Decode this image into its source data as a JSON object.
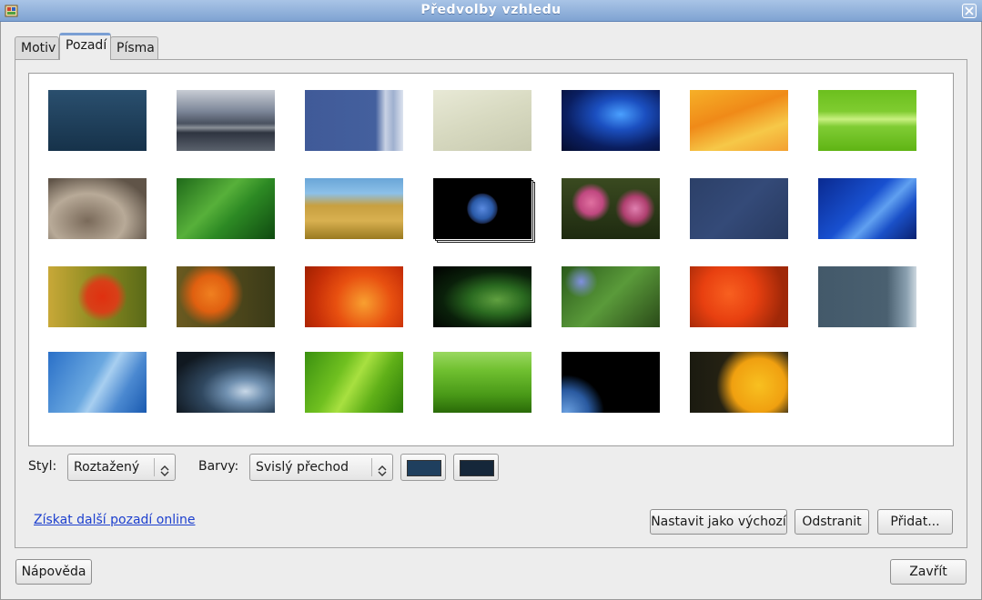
{
  "window": {
    "title": "Předvolby vzhledu"
  },
  "tabs": [
    {
      "label": "Motiv"
    },
    {
      "label": "Pozadí"
    },
    {
      "label": "Písma"
    }
  ],
  "options": {
    "style_label": "Styl:",
    "style_value": "Roztažený",
    "colors_label": "Barvy:",
    "colors_value": "Svislý přechod",
    "primary_color": "#1f3f5e",
    "secondary_color": "#15273a"
  },
  "link": {
    "more_online": "Získat další pozadí online"
  },
  "buttons": {
    "set_default": "Nastavit jako výchozí",
    "remove": "Odstranit",
    "add": "Přidat...",
    "help": "Nápověda",
    "close": "Zavřít"
  },
  "wallpapers": {
    "selected_index": 4,
    "items": [
      "solid-blue",
      "stormy-sky",
      "blue-curtain",
      "sand",
      "blue-swirl",
      "orange-waves",
      "green-waves",
      "stone-fountain",
      "green-leaves",
      "wheat-field",
      "earth",
      "pink-flowers",
      "denim",
      "blue-abstract",
      "red-flower",
      "orange-flower",
      "orange-petals",
      "leaf-bug",
      "blue-flowers",
      "orange-blooms",
      "slate-bubbles",
      "blue-curve",
      "water-drop",
      "green-leaf",
      "grass",
      "earth-night",
      "yellow-flower"
    ]
  }
}
